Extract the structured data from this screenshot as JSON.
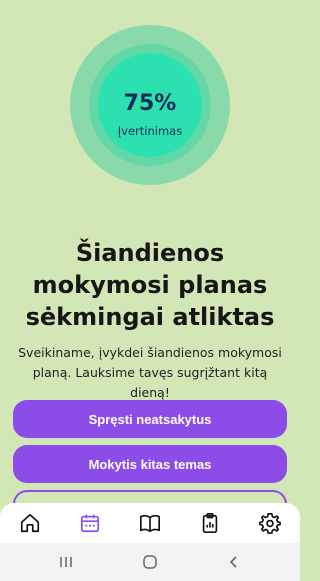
{
  "score": {
    "value": "75%",
    "label": "Įvertinimas"
  },
  "result": {
    "title": "Šiandienos mokymosi planas sėkmingai atliktas",
    "subtitle": "Sveikiname, įvykdei šiandienos mokymosi planą. Lauksime tavęs sugrįžtant kitą dieną!"
  },
  "actions": {
    "solve_unanswered": "Spręsti neatsakytus",
    "learn_other_topics": "Mokytis kitas temas"
  },
  "bottom_nav": {
    "items": [
      {
        "icon": "home-icon",
        "active": false
      },
      {
        "icon": "calendar-icon",
        "active": true
      },
      {
        "icon": "book-icon",
        "active": false
      },
      {
        "icon": "report-icon",
        "active": false
      },
      {
        "icon": "gear-icon",
        "active": false
      }
    ],
    "active_color": "#8b4ce8"
  },
  "system_nav": {
    "items": [
      "recent-apps-icon",
      "home-button-icon",
      "back-icon"
    ]
  },
  "colors": {
    "background": "#d3e6b5",
    "primary": "#8b4ce8",
    "ring_outer": "#8ad9ab",
    "ring_inner": "#2de0b0"
  }
}
